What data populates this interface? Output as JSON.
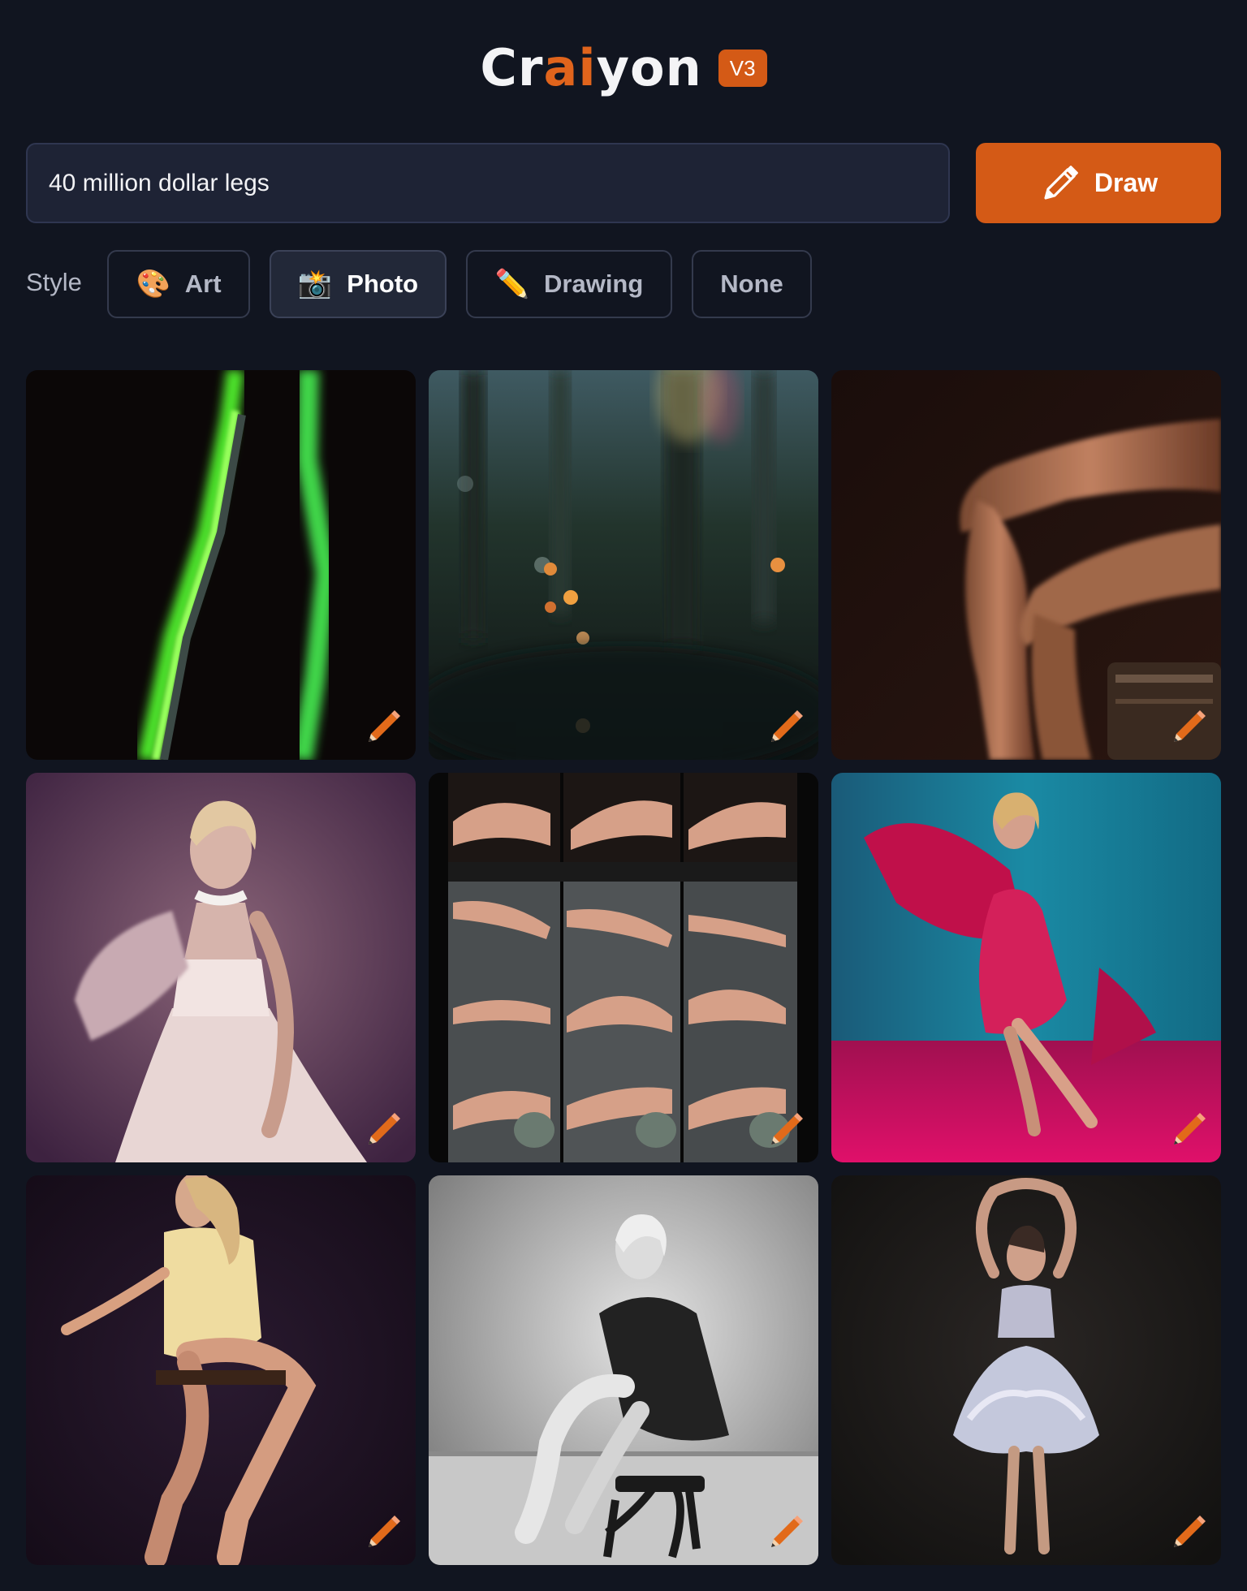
{
  "header": {
    "logo_prefix": "Cr",
    "logo_highlight": "ai",
    "logo_suffix": "yon",
    "version": "V3"
  },
  "prompt": {
    "value": "40 million dollar legs"
  },
  "draw_button": {
    "label": "Draw",
    "icon": "pencil-icon"
  },
  "style": {
    "label": "Style",
    "options": [
      {
        "label": "Art",
        "emoji": "🎨",
        "active": false
      },
      {
        "label": "Photo",
        "emoji": "📸",
        "active": true
      },
      {
        "label": "Drawing",
        "emoji": "✏️",
        "active": false
      },
      {
        "label": "None",
        "emoji": "",
        "active": false
      }
    ]
  },
  "results": {
    "images": [
      {
        "subject": "neon green blurred strands on black"
      },
      {
        "subject": "dark forest bokeh with orange lights"
      },
      {
        "subject": "crossed legs in warm low light"
      },
      {
        "subject": "woman in white gown on purple backdrop"
      },
      {
        "subject": "grid of legs and feet photos"
      },
      {
        "subject": "woman in pink dress on teal and magenta backdrop"
      },
      {
        "subject": "woman in yellow dress sitting, dark background"
      },
      {
        "subject": "black and white woman seated on stool"
      },
      {
        "subject": "woman in lace tutu with arms raised"
      }
    ],
    "edit_icon": "pencil-icon"
  },
  "colors": {
    "background": "#111520",
    "accent": "#d45a16",
    "input_bg": "#1e2335"
  }
}
